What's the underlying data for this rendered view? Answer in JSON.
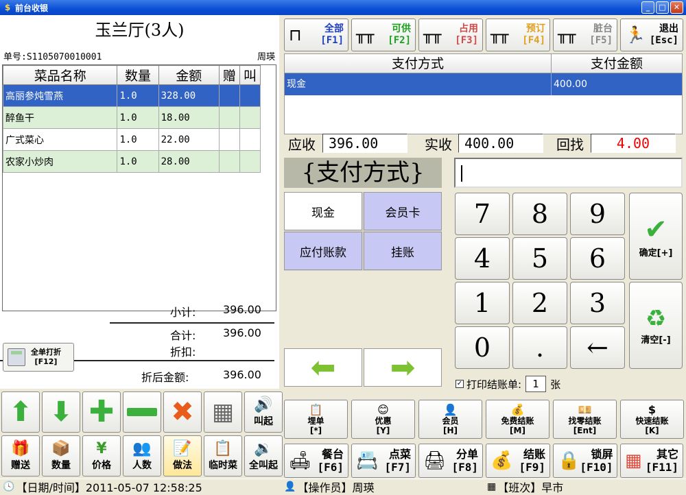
{
  "window": {
    "title": "前台收银"
  },
  "order": {
    "room": "玉兰厅(3人)",
    "order_no": "单号:S1105070010001",
    "waiter": "周瑛",
    "columns": [
      "菜品名称",
      "数量",
      "金额",
      "赠",
      "叫"
    ],
    "items": [
      {
        "name": "高丽参炖雪燕",
        "qty": "1.0",
        "amount": "328.00"
      },
      {
        "name": "醉鱼干",
        "qty": "1.0",
        "amount": "18.00"
      },
      {
        "name": "广式菜心",
        "qty": "1.0",
        "amount": "22.00"
      },
      {
        "name": "农家小炒肉",
        "qty": "1.0",
        "amount": "28.00"
      }
    ],
    "subtotal_label": "小计:",
    "subtotal": "396.00",
    "total_label": "合计:",
    "total": "396.00",
    "discount_label": "折扣:",
    "discount": "",
    "after_label": "折后金额:",
    "after": "396.00"
  },
  "print_all": {
    "label": "全单打折",
    "key": "[F12]"
  },
  "left_toolbar": {
    "call": "叫起",
    "gift": "赠送",
    "qty": "数量",
    "price": "价格",
    "people": "人数",
    "method": "做法",
    "temp": "临时菜",
    "call_all": "全叫起"
  },
  "top_buttons": [
    {
      "label": "全部",
      "key": "[F1]",
      "color": "#1d3fc0"
    },
    {
      "label": "可供",
      "key": "[F2]",
      "color": "#1aa21a"
    },
    {
      "label": "占用",
      "key": "[F3]",
      "color": "#d24a4a"
    },
    {
      "label": "预订",
      "key": "[F4]",
      "color": "#e0a020"
    },
    {
      "label": "脏台",
      "key": "[F5]",
      "color": "#888888"
    },
    {
      "label": "退出",
      "key": "[Esc]",
      "color": "#000000"
    }
  ],
  "payment": {
    "head_method": "支付方式",
    "head_amount": "支付金额",
    "row_method": "现金",
    "row_amount": "400.00",
    "receivable_label": "应收",
    "receivable": "396.00",
    "received_label": "实收",
    "received": "400.00",
    "change_label": "回找",
    "change": "4.00",
    "methods_title": "{支付方式}",
    "methods": [
      "现金",
      "会员卡",
      "应付账款",
      "挂账"
    ]
  },
  "keypad": {
    "keys": [
      "7",
      "8",
      "9",
      "4",
      "5",
      "6",
      "1",
      "2",
      "3",
      "0",
      ".",
      "←"
    ],
    "confirm": "确定[+]",
    "clear": "清空[-]"
  },
  "print_receipt": {
    "label": "打印结账单:",
    "copies": "1",
    "unit": "张"
  },
  "func_buttons": [
    {
      "label": "埋单",
      "key": "[*]",
      "icon": "📋"
    },
    {
      "label": "优惠",
      "key": "[Y]",
      "icon": "😊"
    },
    {
      "label": "会员",
      "key": "[H]",
      "icon": "👤"
    },
    {
      "label": "免费结账",
      "key": "[M]",
      "icon": "💰"
    },
    {
      "label": "找零结账",
      "key": "[Ent]",
      "icon": "💴"
    },
    {
      "label": "快速结账",
      "key": "[K]",
      "icon": "$"
    }
  ],
  "main_buttons": [
    {
      "label": "餐台",
      "key": "[F6]",
      "icon": "🛋"
    },
    {
      "label": "点菜",
      "key": "[F7]",
      "icon": "📇"
    },
    {
      "label": "分单",
      "key": "[F8]",
      "icon": "🖨"
    },
    {
      "label": "结账",
      "key": "[F9]",
      "icon": "💰"
    },
    {
      "label": "锁屏",
      "key": "[F10]",
      "icon": "🔒"
    },
    {
      "label": "其它",
      "key": "[F11]",
      "icon": "▦"
    }
  ],
  "status": {
    "datetime": "【日期/时间】2011-05-07 12:58:25",
    "operator": "【操作员】周瑛",
    "shift": "【班次】早市"
  }
}
